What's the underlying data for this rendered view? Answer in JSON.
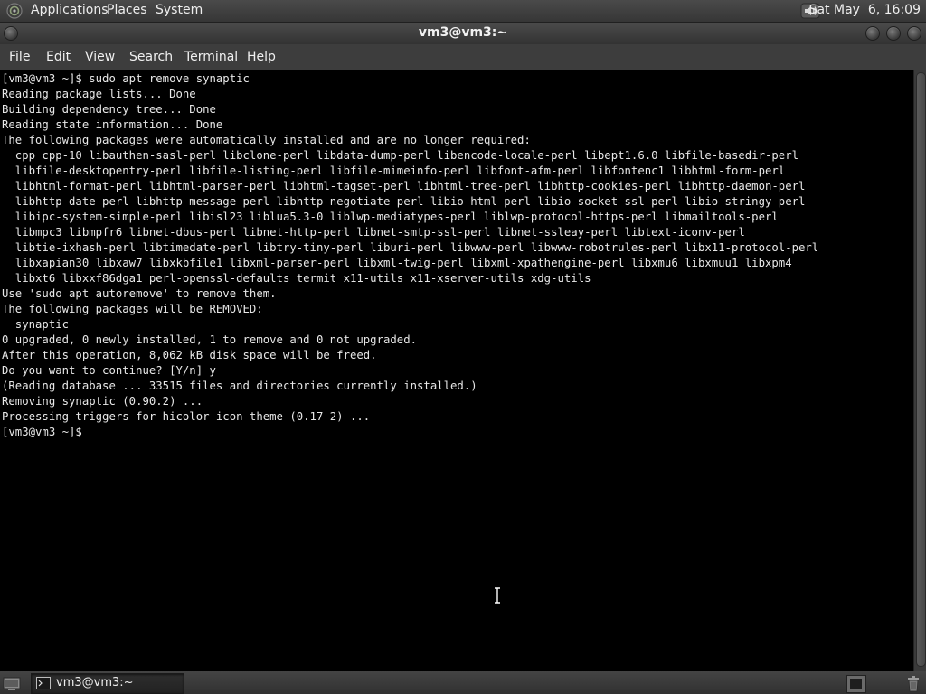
{
  "top_panel": {
    "menus": {
      "applications": "Applications",
      "places": "Places",
      "system": "System"
    },
    "clock": "Sat May  6, 16:09",
    "icons": {
      "logo": "gnome-foot-icon",
      "volume": "volume-icon"
    }
  },
  "window": {
    "title": "vm3@vm3:~",
    "menubar": {
      "file": "File",
      "edit": "Edit",
      "view": "View",
      "search": "Search",
      "terminal": "Terminal",
      "help": "Help"
    }
  },
  "terminal": {
    "lines": [
      "[vm3@vm3 ~]$ sudo apt remove synaptic",
      "Reading package lists... Done",
      "Building dependency tree... Done",
      "Reading state information... Done",
      "The following packages were automatically installed and are no longer required:",
      "  cpp cpp-10 libauthen-sasl-perl libclone-perl libdata-dump-perl libencode-locale-perl libept1.6.0 libfile-basedir-perl",
      "  libfile-desktopentry-perl libfile-listing-perl libfile-mimeinfo-perl libfont-afm-perl libfontenc1 libhtml-form-perl",
      "  libhtml-format-perl libhtml-parser-perl libhtml-tagset-perl libhtml-tree-perl libhttp-cookies-perl libhttp-daemon-perl",
      "  libhttp-date-perl libhttp-message-perl libhttp-negotiate-perl libio-html-perl libio-socket-ssl-perl libio-stringy-perl",
      "  libipc-system-simple-perl libisl23 liblua5.3-0 liblwp-mediatypes-perl liblwp-protocol-https-perl libmailtools-perl",
      "  libmpc3 libmpfr6 libnet-dbus-perl libnet-http-perl libnet-smtp-ssl-perl libnet-ssleay-perl libtext-iconv-perl",
      "  libtie-ixhash-perl libtimedate-perl libtry-tiny-perl liburi-perl libwww-perl libwww-robotrules-perl libx11-protocol-perl",
      "  libxapian30 libxaw7 libxkbfile1 libxml-parser-perl libxml-twig-perl libxml-xpathengine-perl libxmu6 libxmuu1 libxpm4",
      "  libxt6 libxxf86dga1 perl-openssl-defaults termit x11-utils x11-xserver-utils xdg-utils",
      "Use 'sudo apt autoremove' to remove them.",
      "The following packages will be REMOVED:",
      "  synaptic",
      "0 upgraded, 0 newly installed, 1 to remove and 0 not upgraded.",
      "After this operation, 8,062 kB disk space will be freed.",
      "Do you want to continue? [Y/n] y",
      "(Reading database ... 33515 files and directories currently installed.)",
      "Removing synaptic (0.90.2) ...",
      "Processing triggers for hicolor-icon-theme (0.17-2) ...",
      "[vm3@vm3 ~]$ "
    ],
    "colors": {
      "background": "#000000",
      "foreground": "#e8e8e8"
    }
  },
  "bottom_panel": {
    "taskbar": {
      "label": "vm3@vm3:~",
      "icon": "terminal-icon"
    },
    "icons": {
      "show_desktop": "show-desktop-icon",
      "workspace": "workspace-switcher-icon",
      "trash": "trash-icon"
    }
  }
}
